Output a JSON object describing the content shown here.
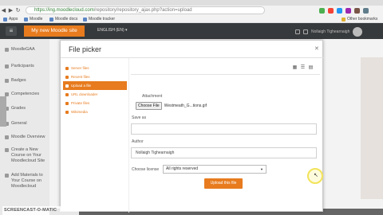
{
  "browser": {
    "url_domain": "https://ing.moodlecloud.com",
    "url_rest": "/repository/repository_ajax.php?action=upload",
    "bookmarks": [
      "Apps",
      "Moodle",
      "Moodle docs",
      "Moodle tracker",
      "Other bookmarks"
    ]
  },
  "header": {
    "site_name": "My new Moodle site",
    "language": "ENGLISH (EN) ▾",
    "user_name": "Nollaigh Tighearnaigh"
  },
  "sidebar": {
    "items": [
      {
        "label": "MoodleGAA"
      },
      {
        "label": "Participants"
      },
      {
        "label": "Badges"
      },
      {
        "label": "Competencies"
      },
      {
        "label": "Grades"
      },
      {
        "label": "General"
      },
      {
        "label": "Moodle Overview"
      },
      {
        "label": "Create a New Course on Your Moodlecloud Site"
      },
      {
        "label": "Add Materials to Your Course on Moodlecloud"
      }
    ]
  },
  "file_picker": {
    "title": "File picker",
    "repositories": [
      {
        "label": "Server files",
        "active": false
      },
      {
        "label": "Recent files",
        "active": false
      },
      {
        "label": "Upload a file",
        "active": true
      },
      {
        "label": "URL downloader",
        "active": false
      },
      {
        "label": "Private files",
        "active": false
      },
      {
        "label": "Wikimedia",
        "active": false
      }
    ],
    "attachment_label": "Attachment",
    "choose_file_label": "Choose File",
    "file_name": "Westmeath_G...tions.gif",
    "save_as_label": "Save as",
    "save_as_value": "",
    "author_label": "Author",
    "author_value": "Nollaigh Tighearnaigh",
    "license_label": "Choose license",
    "license_value": "All rights reserved",
    "upload_button": "Upload this file"
  },
  "watermark": "SCREENCAST-O-MATIC",
  "colors": {
    "accent": "#e77b1e",
    "header_bg": "#373a3c"
  }
}
